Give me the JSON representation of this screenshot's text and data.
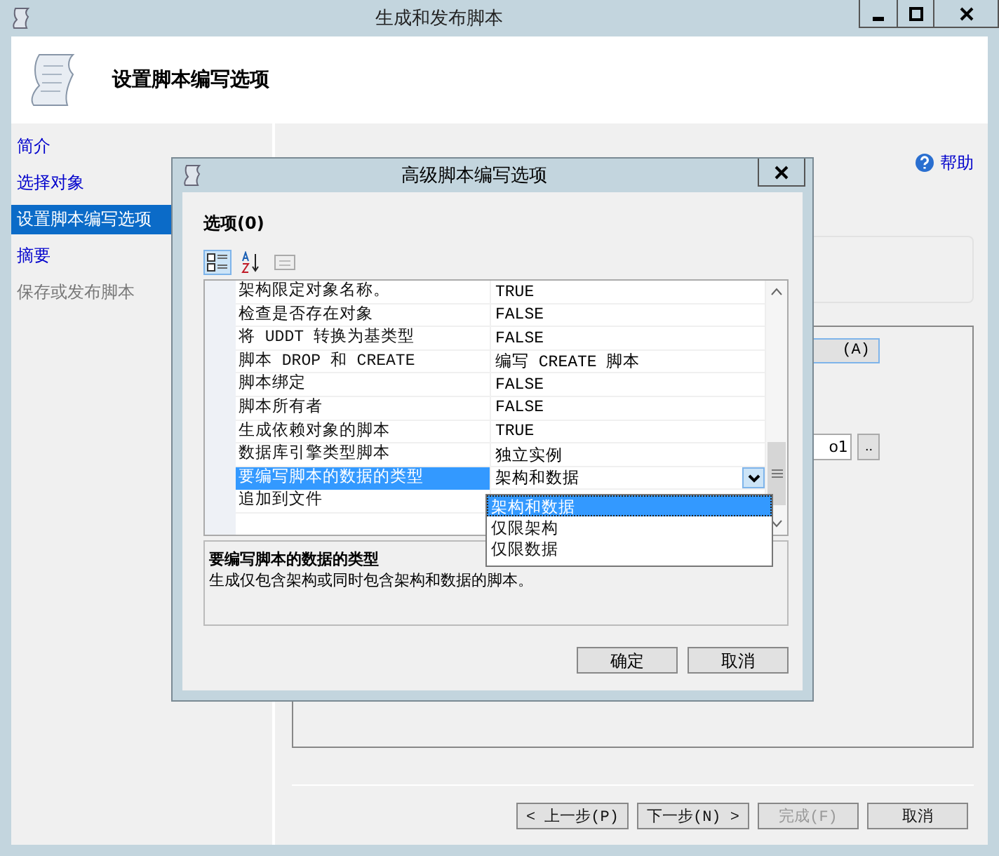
{
  "window": {
    "title": "生成和发布脚本"
  },
  "header": {
    "title": "设置脚本编写选项"
  },
  "help": "帮助",
  "nav": [
    {
      "label": "简介",
      "selected": false,
      "disabled": false
    },
    {
      "label": "选择对象",
      "selected": false,
      "disabled": false
    },
    {
      "label": "设置脚本编写选项",
      "selected": true,
      "disabled": false
    },
    {
      "label": "摘要",
      "selected": false,
      "disabled": false
    },
    {
      "label": "保存或发布脚本",
      "selected": false,
      "disabled": true
    }
  ],
  "background": {
    "button_fragment": "(A)",
    "field_fragment": "o1",
    "browse_button": ".."
  },
  "dialog": {
    "title": "高级脚本编写选项",
    "section": "选项(0)",
    "properties": [
      {
        "name": "架构限定对象名称。",
        "value": "TRUE",
        "selected": false
      },
      {
        "name": "检查是否存在对象",
        "value": "FALSE",
        "selected": false
      },
      {
        "name": "将 UDDT 转换为基类型",
        "value": "FALSE",
        "selected": false
      },
      {
        "name": "脚本 DROP 和 CREATE",
        "value": "编写 CREATE 脚本",
        "selected": false
      },
      {
        "name": "脚本绑定",
        "value": "FALSE",
        "selected": false
      },
      {
        "name": "脚本所有者",
        "value": "FALSE",
        "selected": false
      },
      {
        "name": "生成依赖对象的脚本",
        "value": "TRUE",
        "selected": false
      },
      {
        "name": "数据库引擎类型脚本",
        "value": "独立实例",
        "selected": false
      },
      {
        "name": "要编写脚本的数据的类型",
        "value": "架构和数据",
        "selected": true
      },
      {
        "name": "追加到文件",
        "selected": false
      }
    ],
    "dropdown_options": [
      {
        "label": "架构和数据",
        "selected": true
      },
      {
        "label": "仅限架构",
        "selected": false
      },
      {
        "label": "仅限数据",
        "selected": false
      }
    ],
    "description": {
      "title": "要编写脚本的数据的类型",
      "text": "生成仅包含架构或同时包含架构和数据的脚本。"
    },
    "buttons": [
      "确定",
      "取消"
    ]
  },
  "footer_buttons": [
    {
      "label": "< 上一步(P)",
      "disabled": false
    },
    {
      "label": "下一步(N) >",
      "disabled": false
    },
    {
      "label": "完成(F)",
      "disabled": true
    },
    {
      "label": "取消",
      "disabled": false
    }
  ]
}
